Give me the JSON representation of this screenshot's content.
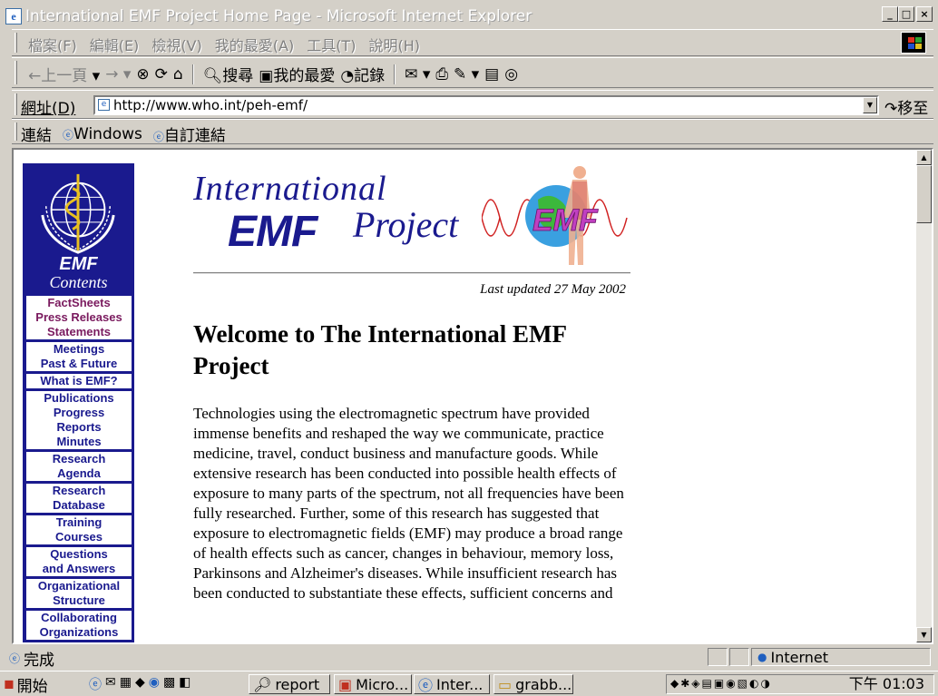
{
  "window": {
    "title": "International EMF Project Home Page - Microsoft Internet Explorer"
  },
  "menu": [
    "檔案(F)",
    "編輯(E)",
    "檢視(V)",
    "我的最愛(A)",
    "工具(T)",
    "說明(H)"
  ],
  "toolbar": {
    "back": "上一頁",
    "search": "搜尋",
    "favorites": "我的最愛",
    "history": "記錄"
  },
  "address": {
    "label": "網址(D)",
    "url": "http://www.who.int/peh-emf/",
    "go": "移至"
  },
  "links": {
    "label": "連結",
    "items": [
      "Windows",
      "自訂連結"
    ]
  },
  "sidebar": {
    "title": "EMF",
    "subtitle": "Contents",
    "items": [
      [
        "FactSheets",
        "Press Releases",
        "Statements"
      ],
      [
        "Meetings",
        "Past & Future"
      ],
      [
        "What is EMF?"
      ],
      [
        "Publications",
        "Progress",
        "Reports",
        "Minutes"
      ],
      [
        "Research",
        "Agenda"
      ],
      [
        "Research",
        "Database"
      ],
      [
        "Training",
        "Courses"
      ],
      [
        "Questions",
        "and Answers"
      ],
      [
        "Organizational",
        "Structure"
      ],
      [
        "Collaborating",
        "Organizations"
      ]
    ]
  },
  "logo": {
    "line1": "International",
    "line2": "EMF",
    "line3": "Project",
    "badge": "EMF"
  },
  "page": {
    "updated": "Last updated 27 May 2002",
    "heading": "Welcome to The International EMF Project",
    "body": "Technologies using the electromagnetic spectrum have provided immense benefits and reshaped the way we communicate, practice medicine, travel, conduct business and manufacture goods. While extensive research has been conducted into possible health effects of exposure to many parts of the spectrum, not all frequencies have been fully researched. Further, some of this research has suggested that exposure to electromagnetic fields (EMF) may produce a broad range of health effects such as cancer, changes in behaviour, memory loss, Parkinsons and Alzheimer's diseases. While insufficient research has been conducted to substantiate these effects, sufficient concerns and"
  },
  "status": {
    "text": "完成",
    "zone": "Internet"
  },
  "taskbar": {
    "start": "開始",
    "buttons": [
      "report",
      "Micro...",
      "Inter...",
      "grabb..."
    ],
    "clock": "下午 01:03"
  }
}
